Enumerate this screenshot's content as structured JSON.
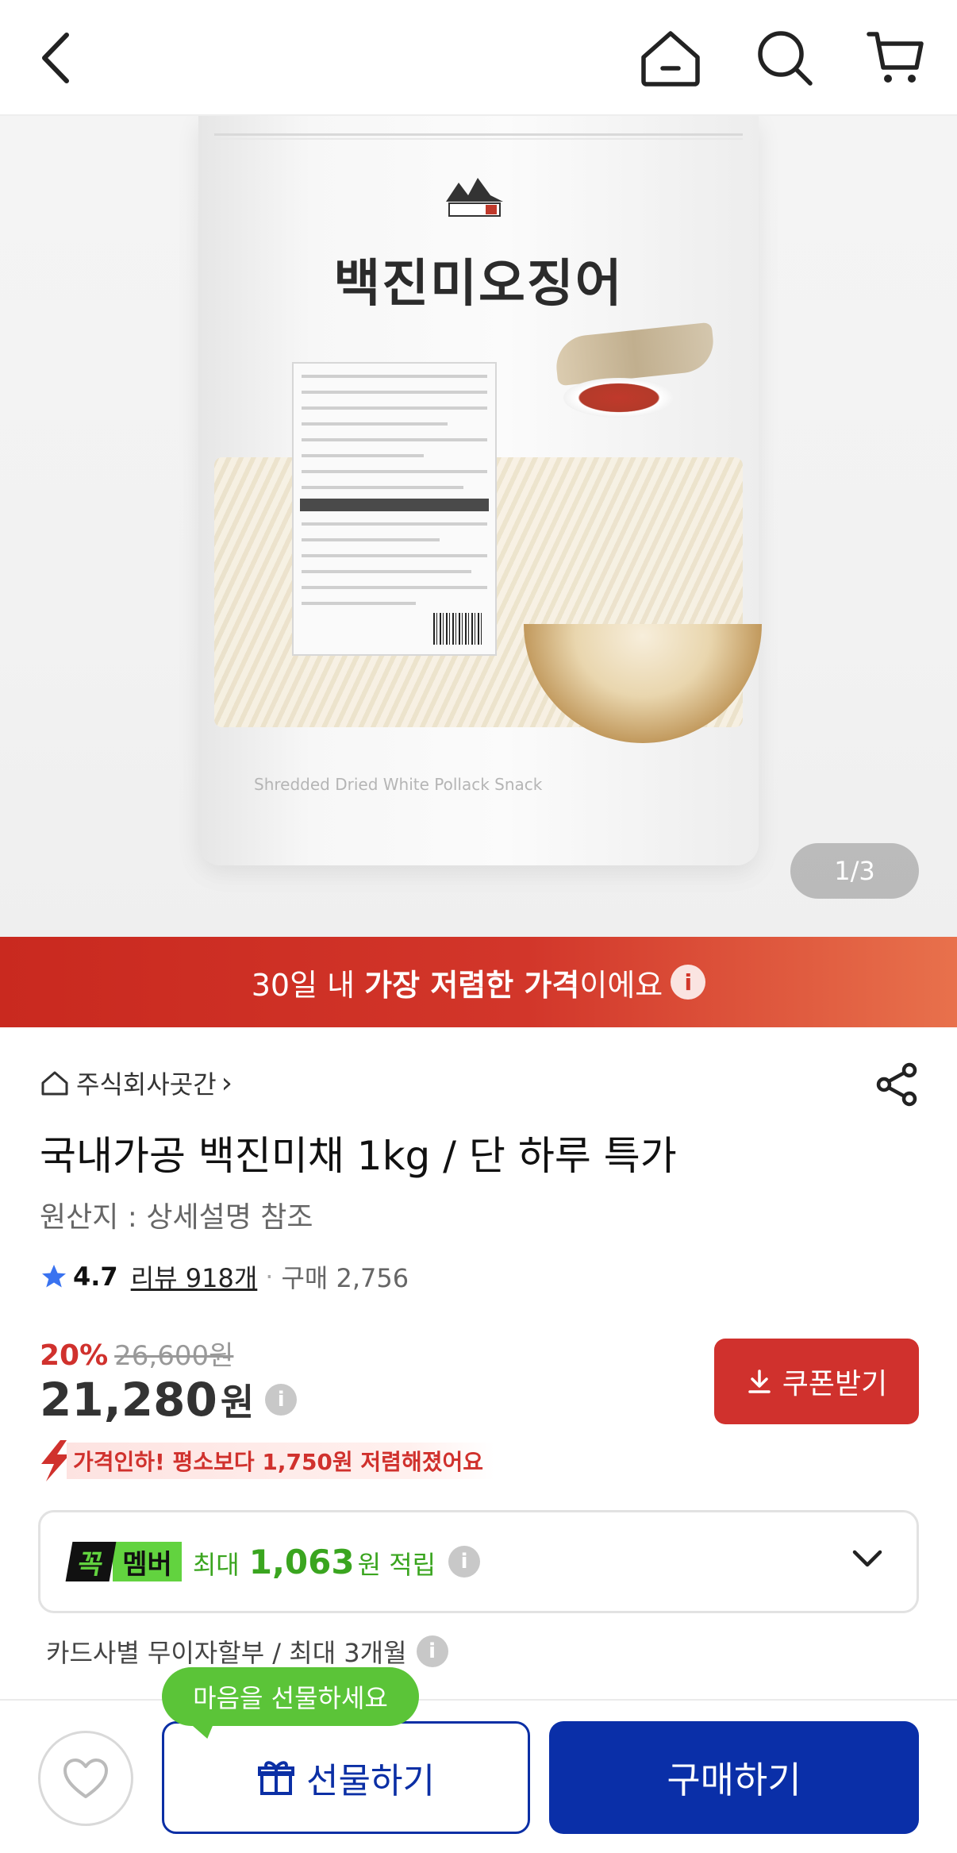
{
  "topbar": {
    "back_icon": "chevron-left-icon",
    "home_icon": "home-icon",
    "search_icon": "search-icon",
    "cart_icon": "cart-icon"
  },
  "hero": {
    "bag_title": "백진미오징어",
    "bag_caption": "Shredded Dried White Pollack Snack",
    "counter": "1/3"
  },
  "banner": {
    "prefix": "30일 내 ",
    "highlight": "가장 저렴한 가격",
    "suffix": "이에요",
    "info": "i",
    "colors": {
      "start": "#c9291f",
      "end": "#e8714c"
    }
  },
  "product": {
    "seller": "주식회사곳간",
    "seller_arrow": "›",
    "title": "국내가공 백진미채 1kg / 단 하루 특가",
    "origin": "원산지 : 상세설명 참조",
    "rating": {
      "score": "4.7",
      "review_text": "리뷰 918개",
      "separator": "·",
      "purchase_text": "구매 2,756"
    }
  },
  "pricing": {
    "discount_pct": "20%",
    "original_price": "26,600원",
    "price": "21,280",
    "price_unit": "원",
    "coupon_label": "쿠폰받기",
    "price_drop": "가격인하! 평소보다 1,750원 저렴해졌어요",
    "accent": "#d0312d"
  },
  "membership": {
    "badge_left": "꼭",
    "badge_right": "멤버",
    "prefix": "최대",
    "amount": "1,063",
    "suffix": "원 적립"
  },
  "installment": "카드사별 무이자할부 / 최대 3개월",
  "bottom": {
    "tooltip": "마음을 선물하세요",
    "gift_label": "선물하기",
    "buy_label": "구매하기",
    "brand": "#0a2fa8"
  }
}
